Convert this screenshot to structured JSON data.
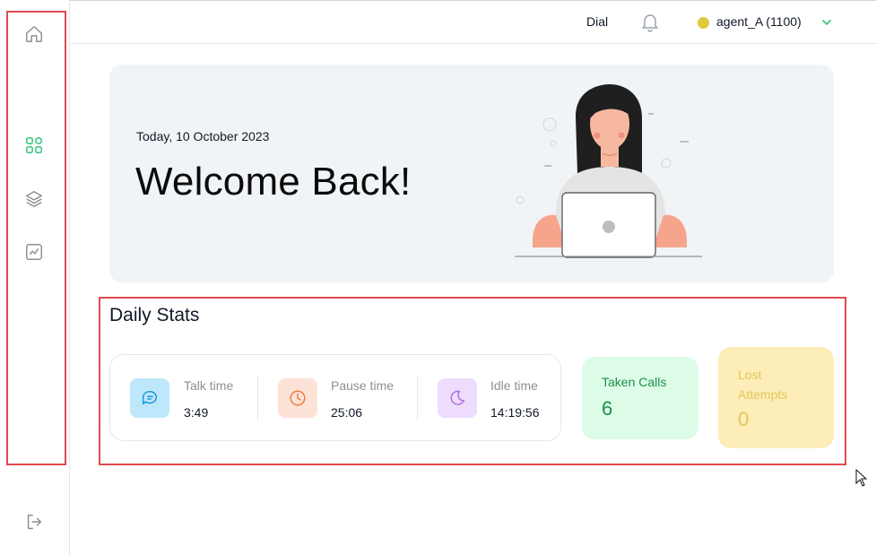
{
  "sidebar": {
    "items": [
      {
        "icon": "home-icon"
      },
      {
        "icon": "dashboard-icon"
      },
      {
        "icon": "layers-icon"
      },
      {
        "icon": "analytics-icon"
      }
    ],
    "logout_icon": "logout-icon"
  },
  "header": {
    "dial_label": "Dial",
    "agent_label": "agent_A (1100)",
    "status_color": "#e0c93a"
  },
  "welcome": {
    "date": "Today, 10 October 2023",
    "title": "Welcome Back!"
  },
  "stats": {
    "title": "Daily Stats",
    "items": [
      {
        "label": "Talk time",
        "value": "3:49"
      },
      {
        "label": "Pause time",
        "value": "25:06"
      },
      {
        "label": "Idle time",
        "value": "14:19:56"
      }
    ],
    "taken_calls": {
      "label": "Taken Calls",
      "value": "6"
    },
    "lost_attempts": {
      "label": "Lost Attempts",
      "value": "0"
    }
  },
  "colors": {
    "accent_green": "#33c57a",
    "highlight_red": "#e04a4f",
    "taken_bg": "#dcfce7",
    "lost_bg": "#fdedb8"
  }
}
